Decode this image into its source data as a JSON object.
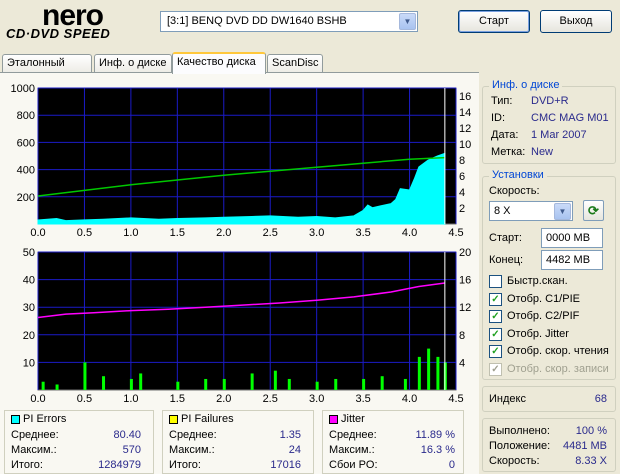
{
  "logo": {
    "brand": "nero",
    "product": "CD·DVD SPEED"
  },
  "drive": {
    "label": "[3:1]  BENQ DVD DD DW1640 BSHB"
  },
  "buttons": {
    "start": "Старт",
    "exit": "Выход"
  },
  "tabs": [
    "Эталонный тест",
    "Инф. о диске",
    "Качество диска",
    "ScanDisc"
  ],
  "disc_info": {
    "title": "Инф. о диске",
    "rows": [
      {
        "k": "Тип:",
        "v": "DVD+R"
      },
      {
        "k": "ID:",
        "v": "CMC MAG M01"
      },
      {
        "k": "Дата:",
        "v": "1 Mar 2007"
      },
      {
        "k": "Метка:",
        "v": "New"
      }
    ]
  },
  "settings": {
    "title": "Установки",
    "speed_label": "Скорость:",
    "speed": "8 X",
    "start_label": "Старт:",
    "start": "0000 MB",
    "end_label": "Конец:",
    "end": "4482 MB",
    "checks": [
      {
        "label": "Быстр.скан.",
        "checked": false,
        "enabled": true
      },
      {
        "label": "Отобр. C1/PIE",
        "checked": true,
        "enabled": true
      },
      {
        "label": "Отобр. C2/PIF",
        "checked": true,
        "enabled": true
      },
      {
        "label": "Отобр. Jitter",
        "checked": true,
        "enabled": true
      },
      {
        "label": "Отобр. скор. чтения",
        "checked": true,
        "enabled": true
      },
      {
        "label": "Отобр. скор. записи",
        "checked": true,
        "enabled": false
      }
    ]
  },
  "index": {
    "label": "Индекс",
    "value": "68"
  },
  "progress": {
    "rows": [
      {
        "k": "Выполнено:",
        "v": "100 %"
      },
      {
        "k": "Положение:",
        "v": "4481 MB"
      },
      {
        "k": "Скорость:",
        "v": "8.33 X"
      }
    ]
  },
  "stats": {
    "pie": {
      "title": "PI Errors",
      "color": "#00FFFF",
      "rows": [
        {
          "k": "Среднее:",
          "v": "80.40"
        },
        {
          "k": "Максим.:",
          "v": "570"
        },
        {
          "k": "Итого:",
          "v": "1284979"
        }
      ]
    },
    "pif": {
      "title": "PI Failures",
      "color": "#FFFF00",
      "rows": [
        {
          "k": "Среднее:",
          "v": "1.35"
        },
        {
          "k": "Максим.:",
          "v": "24"
        },
        {
          "k": "Итого:",
          "v": "17016"
        }
      ]
    },
    "jitter": {
      "title": "Jitter",
      "color": "#FF00FF",
      "rows": [
        {
          "k": "Среднее:",
          "v": "11.89 %"
        },
        {
          "k": "Максим.:",
          "v": "16.3 %"
        },
        {
          "k": "Сбои PO:",
          "v": "0"
        }
      ]
    }
  },
  "chart_data": [
    {
      "type": "area",
      "name": "PI Errors + read speed",
      "x_ticks": [
        "0.0",
        "0.5",
        "1.0",
        "1.5",
        "2.0",
        "2.5",
        "3.0",
        "3.5",
        "4.0",
        "4.5"
      ],
      "y_left_ticks": [
        "200",
        "400",
        "600",
        "800",
        "1000"
      ],
      "y_left_range": [
        0,
        1000
      ],
      "y_right_ticks": [
        "2",
        "4",
        "6",
        "8",
        "10",
        "12",
        "14",
        "16"
      ],
      "y_right_range": [
        0,
        17
      ],
      "xlim": [
        0,
        4.5
      ],
      "series": [
        {
          "axis": "left",
          "color": "#00FFFF",
          "x": [
            0,
            0.1,
            0.2,
            0.3,
            0.5,
            0.7,
            1.0,
            1.3,
            1.5,
            1.8,
            2.0,
            2.3,
            2.5,
            2.8,
            3.0,
            3.2,
            3.4,
            3.5,
            3.55,
            3.6,
            3.8,
            3.85,
            3.9,
            4.0,
            4.05,
            4.1,
            4.2,
            4.3,
            4.38
          ],
          "y": [
            30,
            35,
            40,
            25,
            30,
            35,
            45,
            35,
            40,
            45,
            50,
            55,
            60,
            50,
            55,
            45,
            60,
            100,
            140,
            120,
            150,
            180,
            260,
            250,
            330,
            420,
            470,
            500,
            520
          ]
        },
        {
          "axis": "right",
          "color": "#00C800",
          "x": [
            0,
            0.5,
            1,
            1.5,
            2,
            2.5,
            3,
            3.5,
            4,
            4.38
          ],
          "y": [
            3.5,
            4.2,
            4.9,
            5.5,
            6.1,
            6.6,
            7.1,
            7.6,
            8.1,
            8.3
          ]
        }
      ]
    },
    {
      "type": "bar",
      "name": "PI Failures + jitter",
      "x_ticks": [
        "0.0",
        "0.5",
        "1.0",
        "1.5",
        "2.0",
        "2.5",
        "3.0",
        "3.5",
        "4.0",
        "4.5"
      ],
      "y_left_ticks": [
        "10",
        "20",
        "30",
        "40",
        "50"
      ],
      "y_left_range": [
        0,
        50
      ],
      "y_right_ticks": [
        "4",
        "8",
        "12",
        "16",
        "20"
      ],
      "y_right_range": [
        0,
        20
      ],
      "xlim": [
        0,
        4.5
      ],
      "series": [
        {
          "axis": "left",
          "color": "#00FF00",
          "x": [
            0.05,
            0.2,
            0.5,
            0.7,
            1.0,
            1.1,
            1.5,
            1.8,
            2.0,
            2.3,
            2.55,
            2.7,
            3.0,
            3.2,
            3.5,
            3.7,
            3.95,
            4.1,
            4.2,
            4.3,
            4.38
          ],
          "y": [
            3,
            2,
            10,
            5,
            4,
            6,
            3,
            4,
            4,
            6,
            7,
            4,
            3,
            4,
            4,
            5,
            4,
            12,
            15,
            12,
            10
          ]
        },
        {
          "axis": "right",
          "color": "#FF00FF",
          "x": [
            0,
            0.3,
            0.6,
            1.0,
            1.4,
            1.8,
            2.2,
            2.6,
            3.0,
            3.4,
            3.8,
            4.1,
            4.38
          ],
          "y": [
            10.5,
            11,
            11.2,
            11.5,
            11.7,
            12,
            12.3,
            12.6,
            13,
            13.5,
            14.2,
            15,
            15.5
          ]
        }
      ]
    }
  ]
}
